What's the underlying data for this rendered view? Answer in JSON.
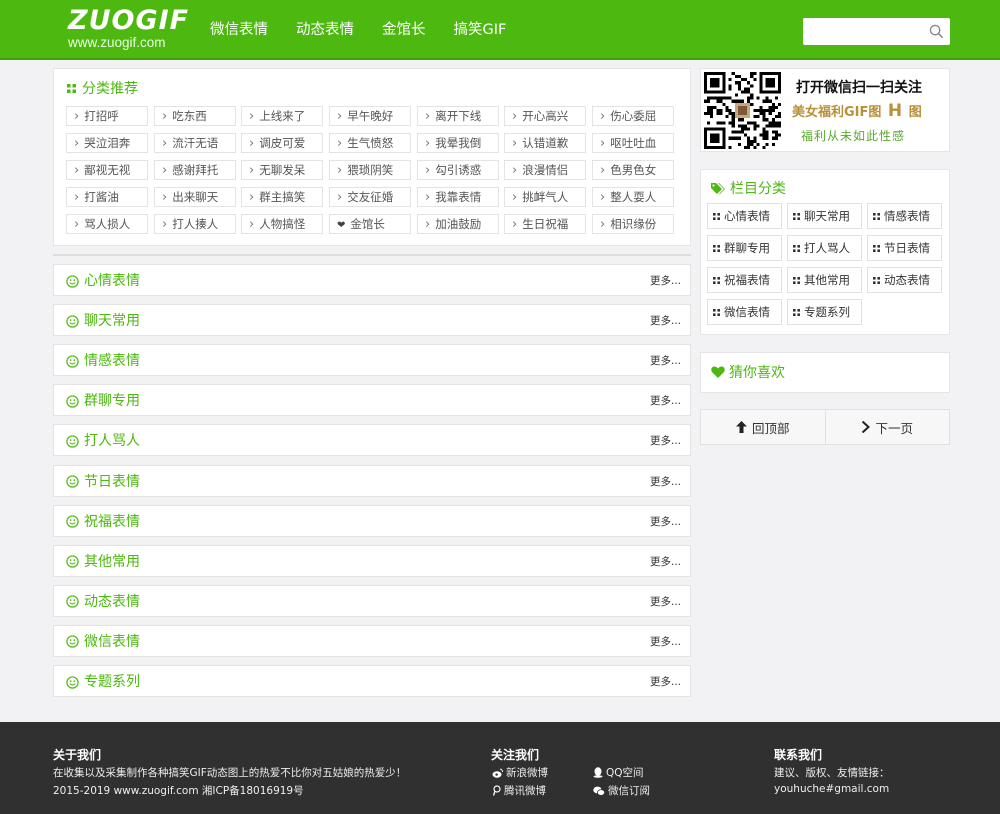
{
  "brand": {
    "logo_text": "ZUOGIF",
    "logo_domain": "www.zuogif.com",
    "accent": "#4cb810"
  },
  "nav": [
    "微信表情",
    "动态表情",
    "金馆长",
    "搞笑GIF"
  ],
  "search": {
    "placeholder": ""
  },
  "categories": {
    "title": "分类推荐",
    "tags": [
      [
        "打招呼",
        "吃东西",
        "上线来了",
        "早午晚好",
        "离开下线",
        "开心高兴",
        "伤心委屈"
      ],
      [
        "哭泣泪奔",
        "流汗无语",
        "调皮可爱",
        "生气愤怒",
        "我晕我倒",
        "认错道歉",
        "呕吐吐血"
      ],
      [
        "鄙视无视",
        "感谢拜托",
        "无聊发呆",
        "猥琐阴笑",
        "勾引诱惑",
        "浪漫情侣",
        "色男色女"
      ],
      [
        "打酱油",
        "出来聊天",
        "群主搞笑",
        "交友征婚",
        "我靠表情",
        "挑衅气人",
        "整人耍人"
      ],
      [
        "骂人损人",
        "打人揍人",
        "人物搞怪",
        "金馆长",
        "加油鼓励",
        "生日祝福",
        "相识缘份"
      ]
    ]
  },
  "sections": {
    "more_label": "更多...",
    "items": [
      "心情表情",
      "聊天常用",
      "情感表情",
      "群聊专用",
      "打人骂人",
      "节日表情",
      "祝福表情",
      "其他常用",
      "动态表情",
      "微信表情",
      "专题系列"
    ]
  },
  "qr_promo": {
    "line1": "打开微信扫一扫关注",
    "line2_a": "美女福利GIF图",
    "line2_b": "H",
    "line2_c": "图",
    "line3": "福利从未如此性感"
  },
  "column_categories": {
    "title": "栏目分类",
    "items": [
      "心情表情",
      "聊天常用",
      "情感表情",
      "群聊专用",
      "打人骂人",
      "节日表情",
      "祝福表情",
      "其他常用",
      "动态表情",
      "微信表情",
      "专题系列"
    ]
  },
  "guess": {
    "title": "猜你喜欢"
  },
  "pager": {
    "top_label": "回顶部",
    "next_label": "下一页"
  },
  "footer": {
    "about_title": "关于我们",
    "about_text": "在收集以及采集制作各种搞笑GIF动态图上的热爱不比你对五姑娘的热爱少！",
    "copyright": "2015-2019 www.zuogif.com 湘ICP备18016919号",
    "follow_title": "关注我们",
    "follow": {
      "weibo": "新浪微博",
      "qzone": "QQ空间",
      "tencent_weibo": "腾讯微博",
      "wechat": "微信订阅"
    },
    "contact_title": "联系我们",
    "contact_text": "建议、版权、友情链接：",
    "contact_email": "youhuche#gmail.com"
  }
}
